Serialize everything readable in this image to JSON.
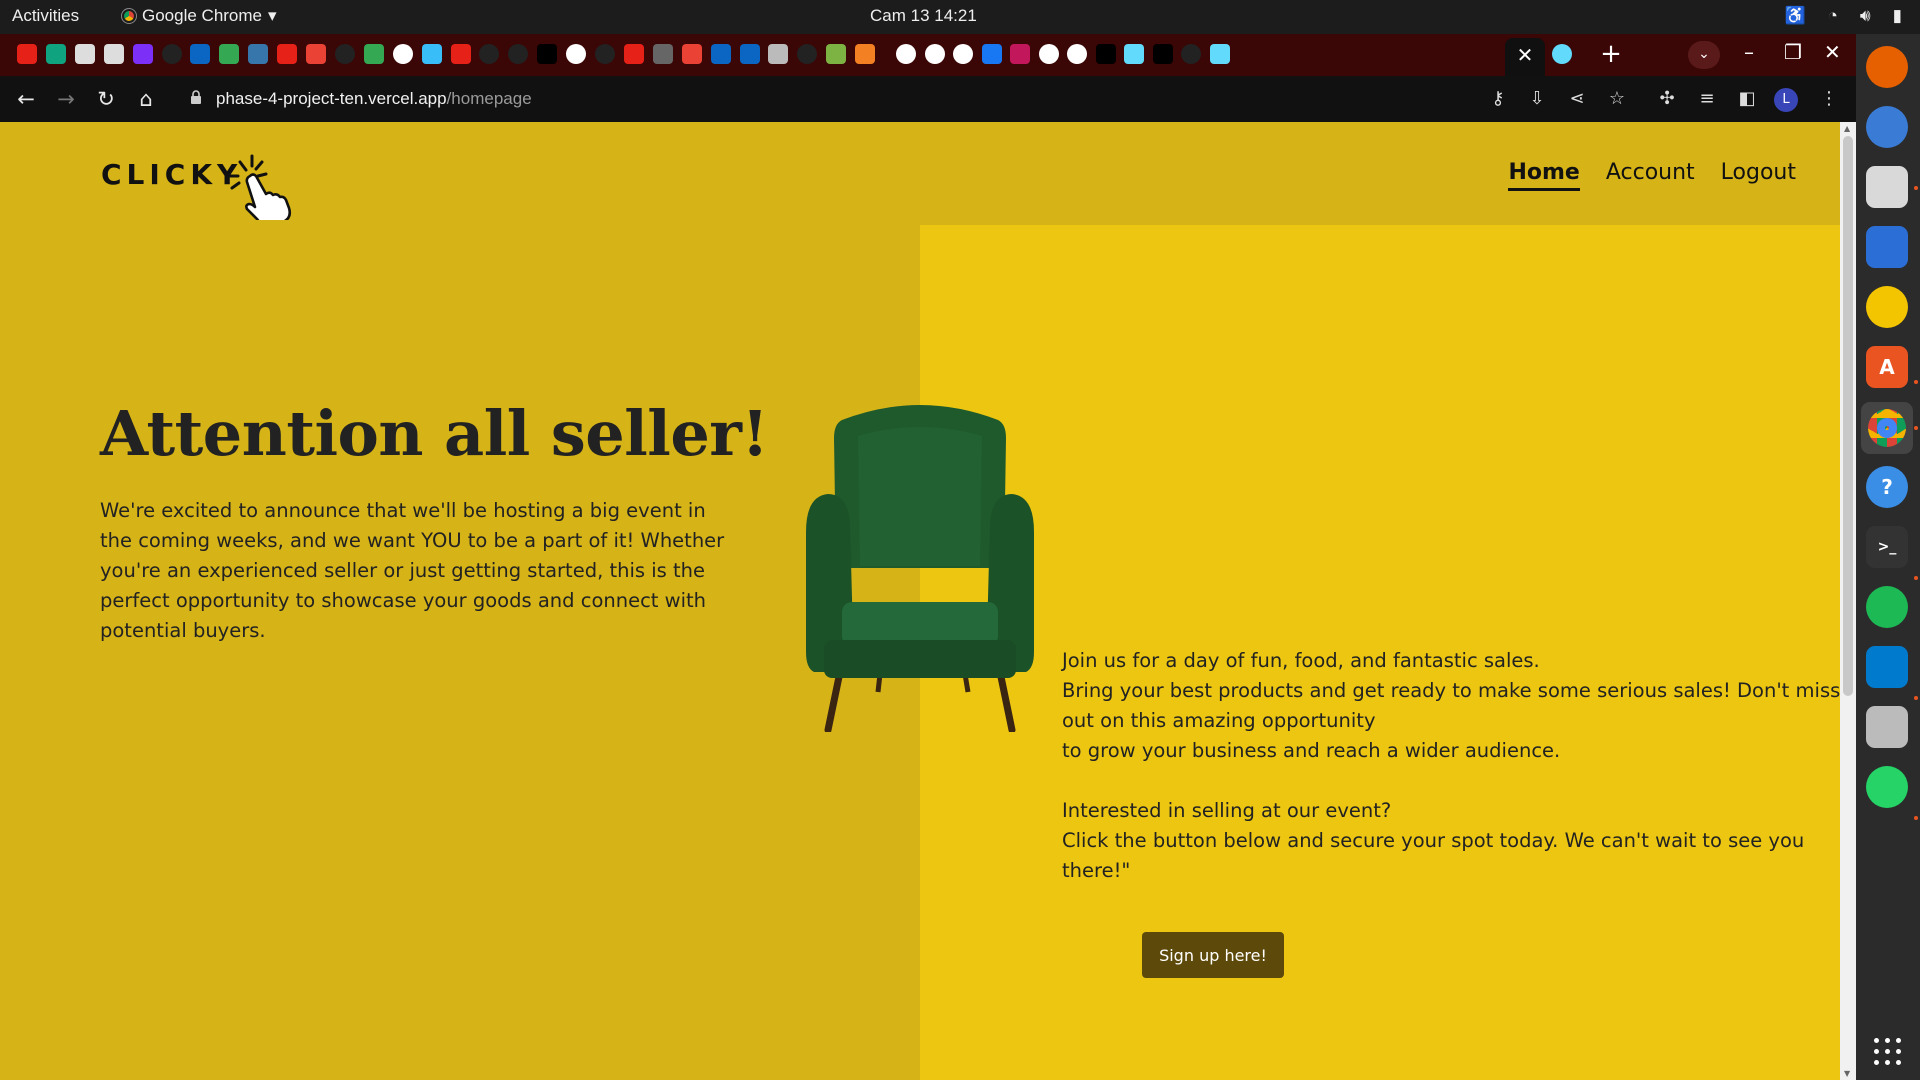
{
  "system": {
    "activities": "Activities",
    "app_name": "Google Chrome",
    "clock": "Cam 13  14:21"
  },
  "browser": {
    "url_host": "phase-4-project-ten.vercel.app",
    "url_path": "/homepage",
    "profile_initial": "L"
  },
  "page": {
    "logo": "CLICKY",
    "nav": {
      "home": "Home",
      "account": "Account",
      "logout": "Logout"
    },
    "headline": "Attention all seller!",
    "intro": "We're excited to announce that we'll be hosting a big event in the coming weeks, and we want YOU to be a part of it! Whether you're an experienced seller or just getting started, this is the perfect opportunity to showcase your goods and connect with potential buyers.",
    "details": "Join us for a day of fun, food, and fantastic sales.\nBring your best products and get ready to make some serious sales! Don't miss out on this amazing opportunity\nto grow your business and reach a wider audience.",
    "cta_intro": "Interested in selling at our event?\nClick the button below and secure your spot today. We can't wait to see you there!\"",
    "signup_button": "Sign up here!"
  },
  "colors": {
    "page_left_bg": "#d6b317",
    "page_right_bg": "#ecc611",
    "button_bg": "#5d4a0a",
    "chair_green": "#1f5a2c",
    "tabstrip_bg": "#3a0606"
  },
  "icons": {
    "tab_favicons": [
      "youtube",
      "chatgpt",
      "app",
      "app",
      "list",
      "github",
      "linkedin",
      "drive",
      "python",
      "youtube",
      "gmail",
      "github",
      "drive",
      "globe",
      "tailwind",
      "youtube",
      "github",
      "github",
      "vercel",
      "speed",
      "github",
      "youtube",
      "doc",
      "gmail",
      "linkedin",
      "linkedin",
      "image",
      "github",
      "leaf",
      "stack",
      "globe",
      "google",
      "google",
      "facebook",
      "word",
      "google",
      "chrome",
      "lush",
      "react",
      "medium",
      "github",
      "react"
    ]
  }
}
